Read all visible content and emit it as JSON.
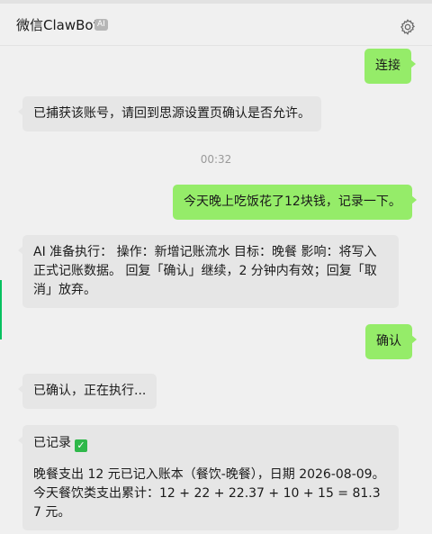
{
  "header": {
    "title": "微信ClawBot",
    "badge": "AI"
  },
  "icons": {
    "settings": "gear-icon",
    "confirmed": "check-mark-icon"
  },
  "colors": {
    "me_bubble": "#95ec69",
    "bot_bubble": "#e6e6e6",
    "accent": "#07c160"
  },
  "messages": [
    {
      "from": "me",
      "text": "连接"
    },
    {
      "from": "bot",
      "text": "已捕获该账号，请回到思源设置页确认是否允许。"
    },
    {
      "from": "me",
      "text": "今天晚上吃饭花了12块钱，记录一下。"
    },
    {
      "from": "bot",
      "text": "AI 准备执行： 操作：新增记账流水 目标：晚餐 影响：将写入正式记账数据。 回复「确认」继续，2 分钟内有效；回复「取消」放弃。"
    },
    {
      "from": "me",
      "text": "确认"
    },
    {
      "from": "bot",
      "text": "已确认，正在执行..."
    },
    {
      "from": "bot",
      "title": "已记录",
      "line1": "晚餐支出 12 元已记入账本（餐饮-晚餐），日期 2026-08-09。",
      "line2": "今天餐饮类支出累计：12 + 22 + 22.37 + 10 + 15 = 81.37 元。"
    }
  ],
  "timestamp": "00:32"
}
